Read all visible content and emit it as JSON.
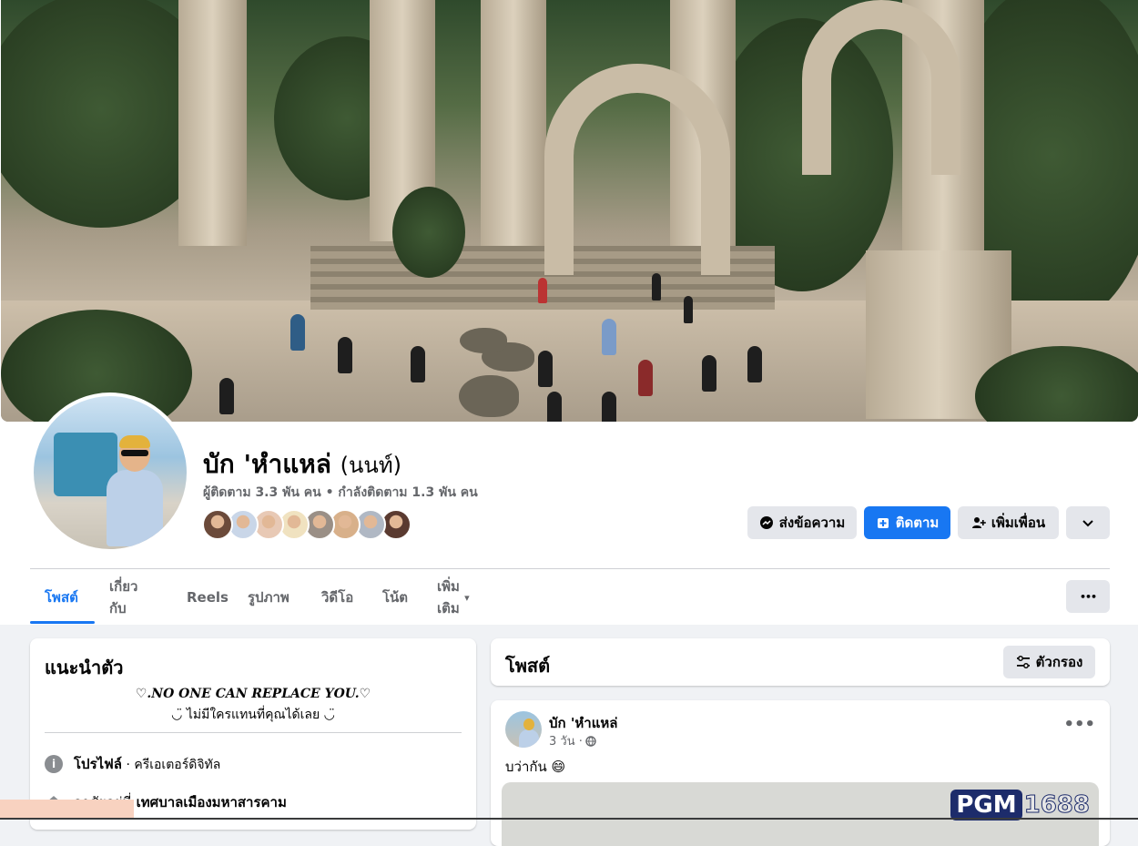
{
  "profile": {
    "name": "บัก 'หำแหล่",
    "nickname": "(นนท์)",
    "stats": "ผู้ติดตาม 3.3 พัน คน • กำลังติดตาม 1.3 พัน คน",
    "friend_colors": [
      "#6b4a3a",
      "#c9d6e8",
      "#e8c9b5",
      "#f0e2c0",
      "#9a8f86",
      "#d8b08a",
      "#b0b8c4",
      "#5a3a30"
    ]
  },
  "actions": {
    "message": "ส่งข้อความ",
    "follow": "ติดตาม",
    "add_friend": "เพิ่มเพื่อน",
    "more": "⌄"
  },
  "tabs": [
    "โพสต์",
    "เกี่ยวกับ",
    "Reels",
    "รูปภาพ",
    "วิดีโอ",
    "โน้ต",
    "เพิ่มเติม"
  ],
  "tabs_active": "โพสต์",
  "tab_more_caret": "▾",
  "tab_overflow": "•••",
  "intro": {
    "title": "แนะนำตัว",
    "bio_line1": "♡.NO ONE CAN REPLACE YOU.♡",
    "bio_line2": "◡̈ ไม่มีใครแทนที่คุณได้เลย ◡̈",
    "profile_label": "โปรไฟล์",
    "profile_value": " · ครีเอเตอร์ดิจิทัล",
    "location_label": "อาศัยอยู่ที่",
    "location_value": " เทศบาลเมืองมหาสารคาม"
  },
  "posts": {
    "title": "โพสต์",
    "filter_label": "ตัวกรอง",
    "post": {
      "author": "บัก 'หำแหล่",
      "time": "3 วัน ·",
      "text": "บว่ากัน 😄",
      "dots": "•••",
      "ad_brand": "PGM",
      "ad_number": "1688"
    }
  },
  "colors": {
    "accent": "#1877f2",
    "background": "#f0f2f5",
    "secondary_text": "#65676b"
  }
}
